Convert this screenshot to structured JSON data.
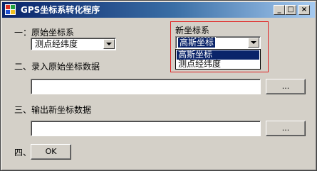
{
  "window": {
    "title": "GPS坐标系转化程序",
    "minimize_label": "_",
    "maximize_label": "□",
    "close_label": "×"
  },
  "section1": {
    "label": "一：原始坐标系",
    "selected": "测点经纬度"
  },
  "new_coord": {
    "label": "新坐标系",
    "selected": "高斯坐标",
    "options": [
      "高斯坐标",
      "测点经纬度"
    ]
  },
  "section2": {
    "label": "二、录入原始坐标数据",
    "input_value": "",
    "browse_label": "..."
  },
  "section3": {
    "label": "三、输出新坐标数据",
    "input_value": "",
    "browse_label": "..."
  },
  "section4": {
    "label": "四、",
    "ok_label": "OK"
  }
}
